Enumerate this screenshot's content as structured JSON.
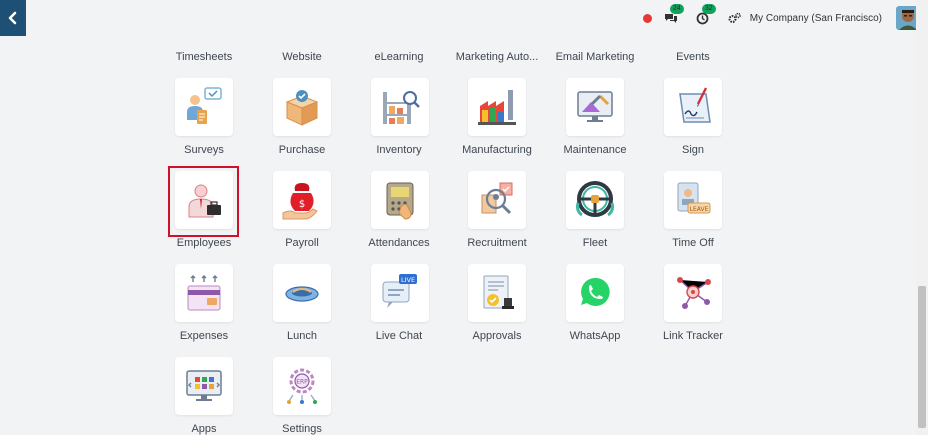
{
  "topbar": {
    "back_icon": "chevron-left-icon",
    "messages_count": "24",
    "activities_count": "32",
    "company": "My Company (San Francisco)"
  },
  "colors": {
    "back_bg": "#1e4f74",
    "highlight": "#d0112b",
    "badge": "#12a25b"
  },
  "row0": [
    "Timesheets",
    "Website",
    "eLearning",
    "Marketing Auto...",
    "Email Marketing",
    "Events"
  ],
  "apps": [
    {
      "label": "Surveys",
      "icon": "surveys-icon"
    },
    {
      "label": "Purchase",
      "icon": "purchase-icon"
    },
    {
      "label": "Inventory",
      "icon": "inventory-icon"
    },
    {
      "label": "Manufacturing",
      "icon": "manufacturing-icon"
    },
    {
      "label": "Maintenance",
      "icon": "maintenance-icon"
    },
    {
      "label": "Sign",
      "icon": "sign-icon"
    },
    {
      "label": "Employees",
      "icon": "employees-icon"
    },
    {
      "label": "Payroll",
      "icon": "payroll-icon"
    },
    {
      "label": "Attendances",
      "icon": "attendances-icon"
    },
    {
      "label": "Recruitment",
      "icon": "recruitment-icon"
    },
    {
      "label": "Fleet",
      "icon": "fleet-icon"
    },
    {
      "label": "Time Off",
      "icon": "time-off-icon"
    },
    {
      "label": "Expenses",
      "icon": "expenses-icon"
    },
    {
      "label": "Lunch",
      "icon": "lunch-icon"
    },
    {
      "label": "Live Chat",
      "icon": "live-chat-icon"
    },
    {
      "label": "Approvals",
      "icon": "approvals-icon"
    },
    {
      "label": "WhatsApp",
      "icon": "whatsapp-icon"
    },
    {
      "label": "Link Tracker",
      "icon": "link-tracker-icon"
    },
    {
      "label": "Apps",
      "icon": "apps-icon"
    },
    {
      "label": "Settings",
      "icon": "settings-icon"
    }
  ],
  "icon_text": {
    "live_chat": "LIVE",
    "time_off": "LEAVE",
    "settings": "ERP"
  }
}
